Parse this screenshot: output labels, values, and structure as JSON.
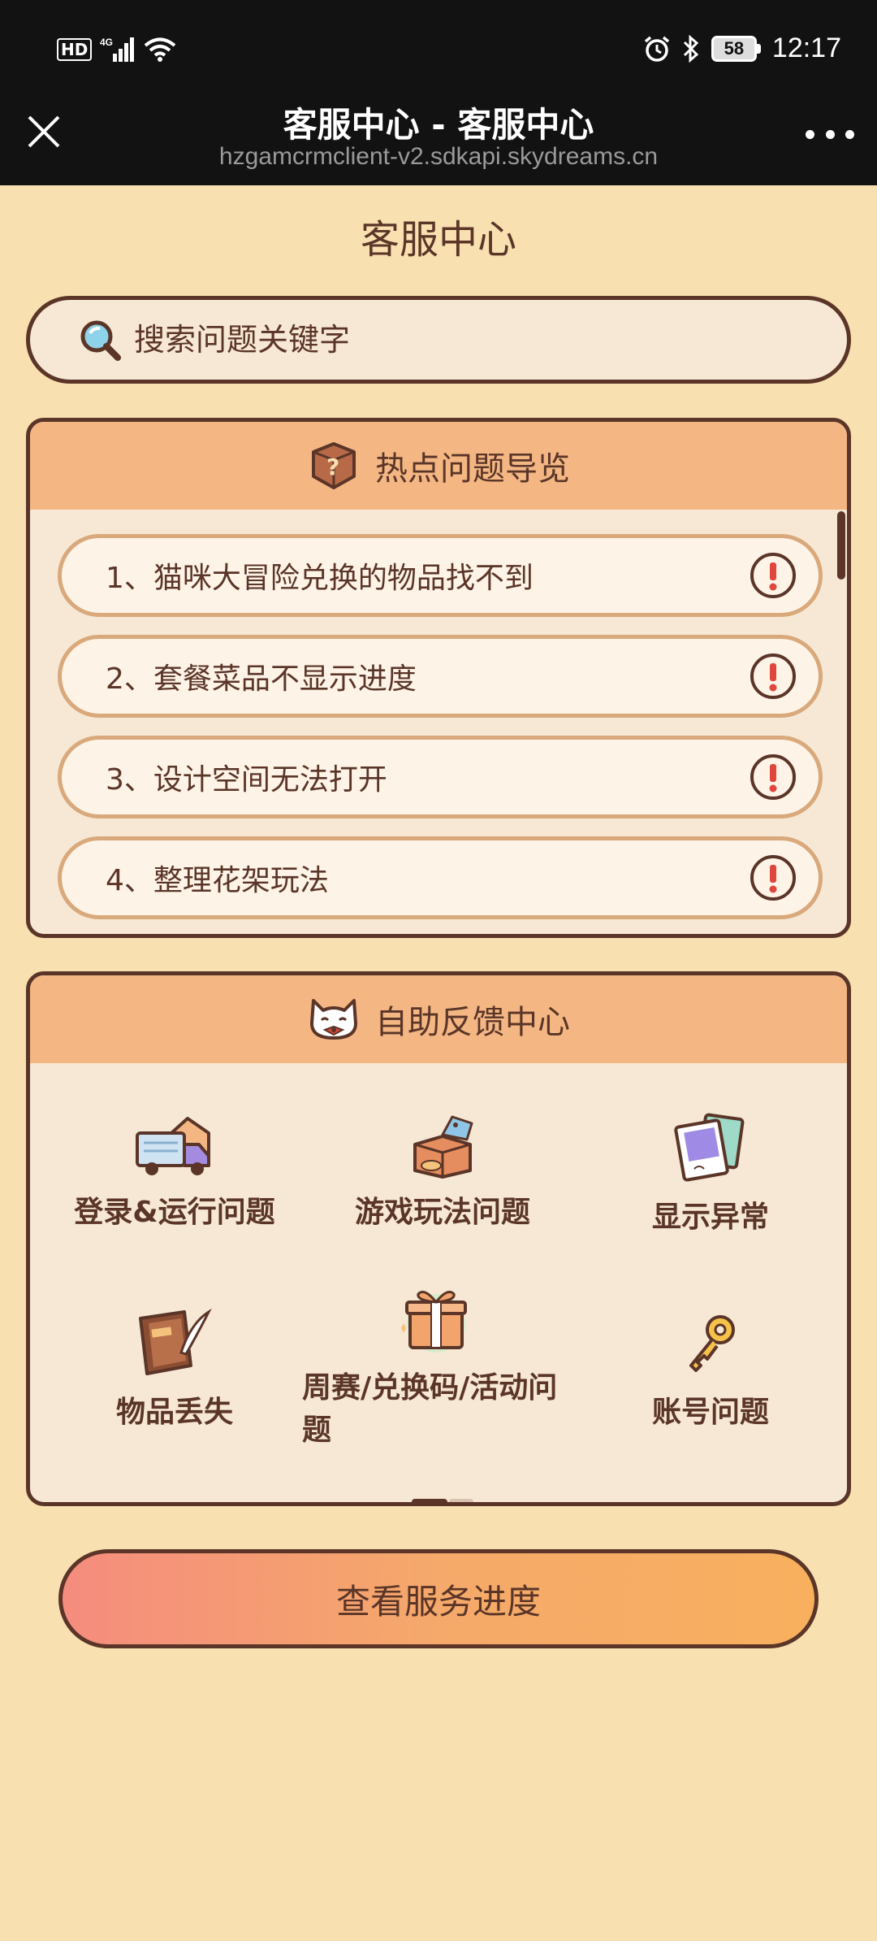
{
  "status_bar": {
    "hd_label": "HD",
    "network": "4G",
    "time": "12:17",
    "battery": "58"
  },
  "title_bar": {
    "title": "客服中心 - 客服中心",
    "url": "hzgamcrmclient-v2.sdkapi.skydreams.cn"
  },
  "page": {
    "title": "客服中心"
  },
  "search": {
    "placeholder": "搜索问题关键字"
  },
  "hot_questions": {
    "heading": "热点问题导览",
    "items": [
      {
        "label": "1、猫咪大冒险兑换的物品找不到"
      },
      {
        "label": "2、套餐菜品不显示进度"
      },
      {
        "label": "3、设计空间无法打开"
      },
      {
        "label": "4、整理花架玩法"
      }
    ]
  },
  "self_help": {
    "heading": "自助反馈中心",
    "items": [
      {
        "label": "登录&运行问题",
        "icon": "delivery-truck-icon"
      },
      {
        "label": "游戏玩法问题",
        "icon": "box-tag-icon"
      },
      {
        "label": "显示异常",
        "icon": "photos-icon"
      },
      {
        "label": "物品丢失",
        "icon": "book-quill-icon"
      },
      {
        "label": "周赛/兑换码/活动问题",
        "icon": "gift-icon"
      },
      {
        "label": "账号问题",
        "icon": "key-icon"
      }
    ]
  },
  "footer": {
    "progress_button": "查看服务进度"
  },
  "colors": {
    "background": "#f9e0b0",
    "border": "#5a3528",
    "card_header": "#f4b784",
    "card_body": "#f6e8d4"
  }
}
